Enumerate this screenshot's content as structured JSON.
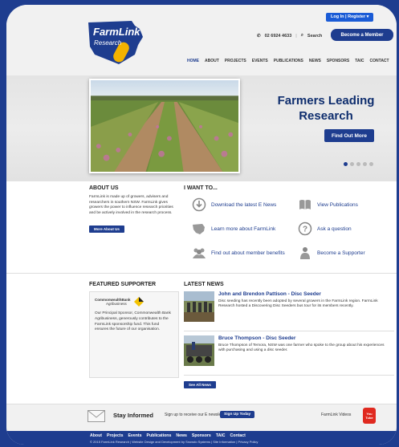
{
  "header": {
    "logo_line1": "FarmLink",
    "logo_line2": "Research",
    "login": "Log In",
    "register": "Register",
    "phone": "02 6924 4633",
    "search": "Search",
    "member_button": "Become a Member",
    "nav": [
      "HOME",
      "ABOUT",
      "PROJECTS",
      "EVENTS",
      "PUBLICATIONS",
      "NEWS",
      "SPONSORS",
      "TAIC",
      "CONTACT"
    ],
    "active_nav": "HOME"
  },
  "hero": {
    "title_line1": "Farmers Leading",
    "title_line2": "Research",
    "button": "Find Out More",
    "slides": 5,
    "active_slide": 1
  },
  "about": {
    "title": "ABOUT US",
    "text": "FarmLink is made up of growers, advisers and researchers in southern NSW. FarmLink gives growers the power to influence research priorities and be actively involved in the research process.",
    "button": "More About Us"
  },
  "iwant": {
    "title": "I WANT TO...",
    "items": [
      {
        "label": "Download the latest E News",
        "icon": "download-icon"
      },
      {
        "label": "View Publications",
        "icon": "publications-icon"
      },
      {
        "label": "Learn more about FarmLink",
        "icon": "map-icon"
      },
      {
        "label": "Ask a question",
        "icon": "question-icon"
      },
      {
        "label": "Find out about member benefits",
        "icon": "members-icon"
      },
      {
        "label": "Become a Supporter",
        "icon": "supporter-icon"
      }
    ]
  },
  "featured": {
    "title": "FEATURED SUPPORTER",
    "logo_name": "CommonwealthBank",
    "logo_sub": "Agribusiness",
    "text": "Our Principal Sponsor, Commonwealth Bank Agribusiness, generously contributes to the FarmLink sponsorship fund. This fund ensures the future of our organisation."
  },
  "news": {
    "title": "LATEST NEWS",
    "items": [
      {
        "headline": "John and Brendon Pattison - Disc Seeder",
        "text": "Disc seeding has recently been adopted by several growers in the FarmLink region. FarmLink Research hosted a Discovering Disc Seeders bus tour for its members recently."
      },
      {
        "headline": "Bruce Thompson - Disc Seeder",
        "text": "Bruce Thompson of Temora, NSW was one farmer who spoke to the group about his experiences with purchasing and using a disc seeder."
      }
    ],
    "button": "See All News"
  },
  "stay": {
    "title": "Stay Informed",
    "text": "Sign up to receive our E newsletter",
    "button": "Sign Up Today",
    "videos": "FarmLink Videos",
    "yt_top": "You",
    "yt_bottom": "Tube"
  },
  "footer": {
    "nav": [
      "About",
      "Projects",
      "Events",
      "Publications",
      "News",
      "Sponsors",
      "TAIC",
      "Contact"
    ],
    "copyright": "© 2015 FarmLink Research | Website Design and Development by Snowdo Systems | Site Information | Privacy Policy"
  },
  "colors": {
    "brand_blue": "#1e3d8f",
    "accent_blue": "#1a5bd6",
    "logo_yellow": "#f3b200",
    "youtube_red": "#e02a20"
  }
}
